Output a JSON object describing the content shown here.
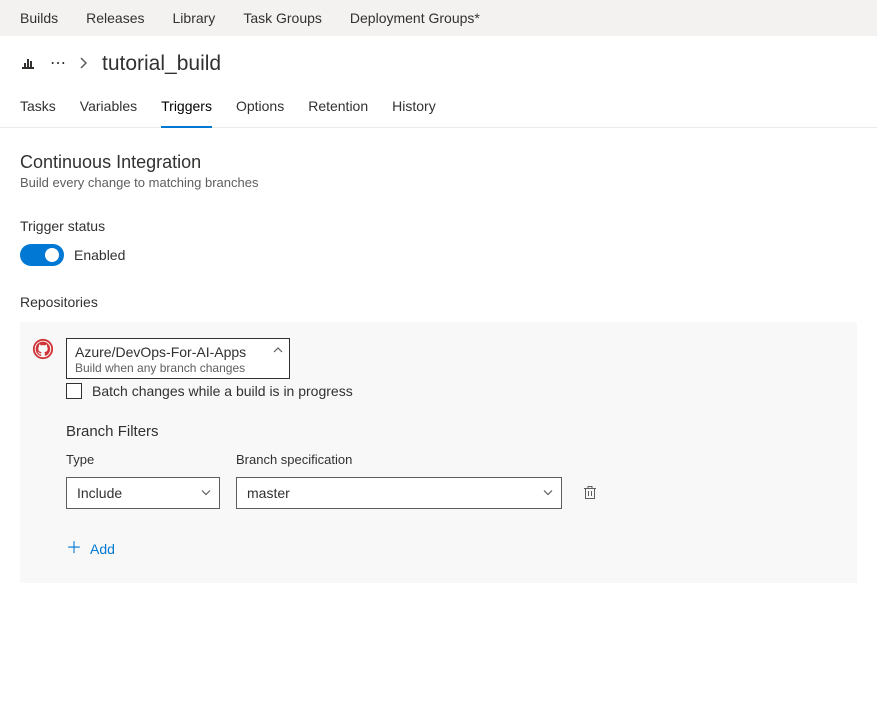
{
  "topnav": {
    "items": [
      "Builds",
      "Releases",
      "Library",
      "Task Groups",
      "Deployment Groups*"
    ]
  },
  "breadcrumb": {
    "title": "tutorial_build"
  },
  "subtabs": {
    "items": [
      "Tasks",
      "Variables",
      "Triggers",
      "Options",
      "Retention",
      "History"
    ],
    "active": "Triggers"
  },
  "ci": {
    "title": "Continuous Integration",
    "subtitle": "Build every change to matching branches"
  },
  "trigger": {
    "label": "Trigger status",
    "state_label": "Enabled"
  },
  "repos": {
    "label": "Repositories",
    "selected": {
      "name": "Azure/DevOps-For-AI-Apps",
      "subtitle": "Build when any branch changes"
    },
    "batch_label": "Batch changes while a build is in progress",
    "filters_title": "Branch Filters",
    "type_label": "Type",
    "branch_label": "Branch specification",
    "row": {
      "type": "Include",
      "branch": "master"
    },
    "add_label": "Add"
  }
}
